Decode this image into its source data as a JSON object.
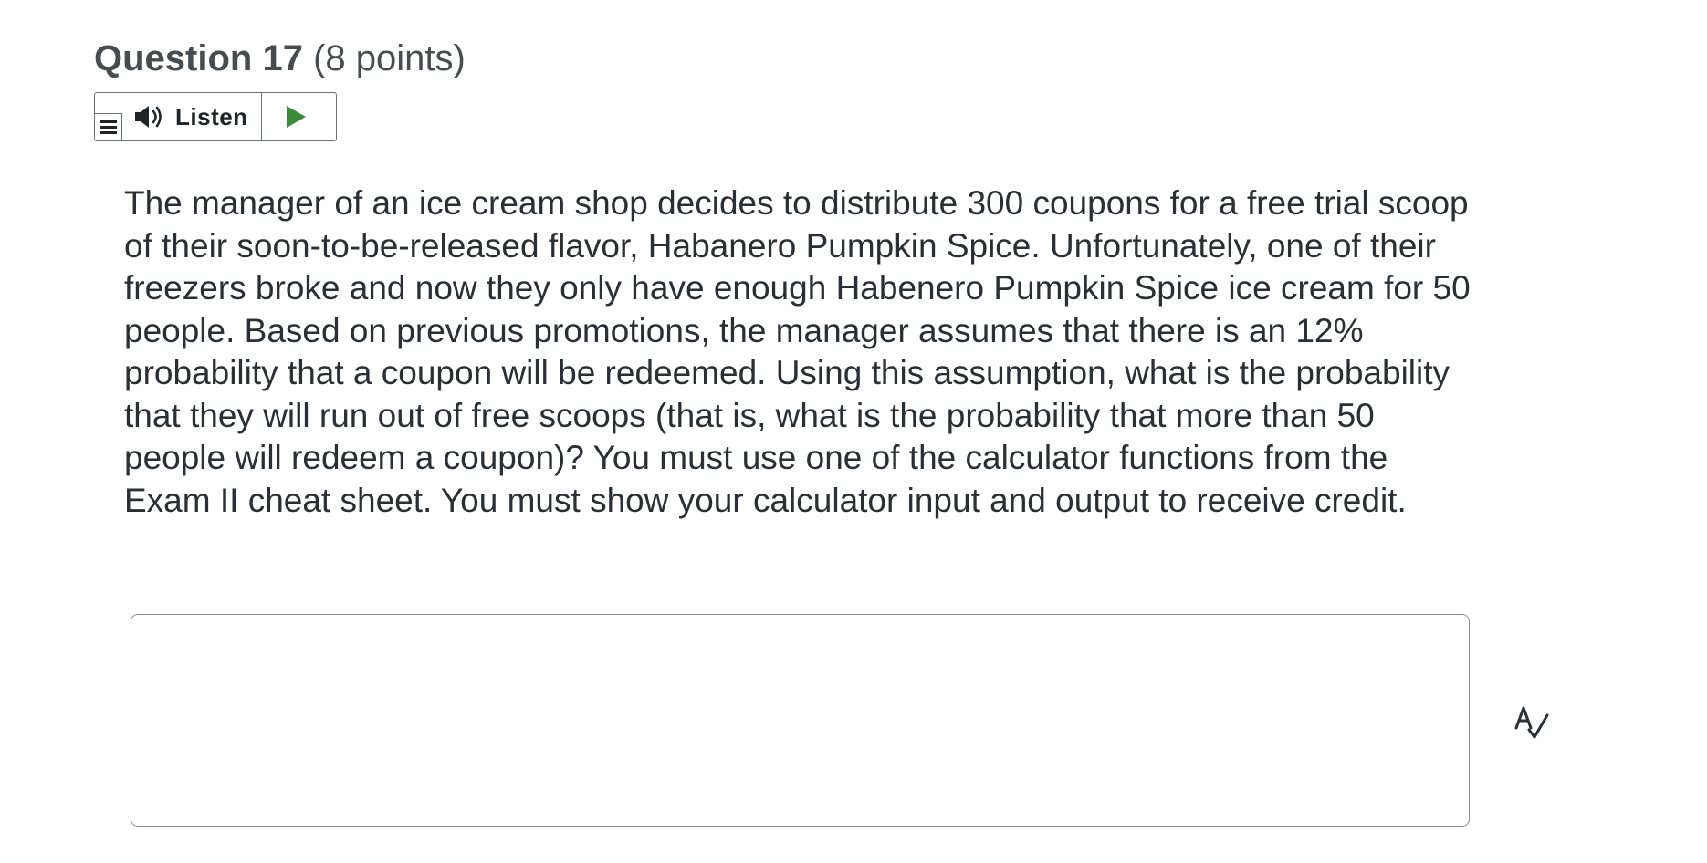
{
  "question": {
    "number_label": "Question 17",
    "points_label": "(8 points)"
  },
  "listen": {
    "label": "Listen",
    "menu_icon": "hamburger-menu-icon",
    "speaker_icon": "speaker-icon",
    "play_icon": "play-icon",
    "play_color": "#3c8a3c"
  },
  "body": {
    "text": "The manager of an ice cream shop decides to distribute 300 coupons for a free trial scoop of their soon-to-be-released flavor, Habanero Pumpkin Spice. Unfortunately, one of their freezers broke and now they only have enough Habenero Pumpkin Spice ice cream for 50 people. Based on previous promotions, the manager assumes that there is an 12% probability that a coupon will be redeemed. Using this assumption, what is the probability that they will run out of free scoops (that is, what is the probability that more than 50 people will redeem a coupon)?  You must use one of the calculator functions from the Exam II cheat sheet. You must show your calculator input and output to receive credit."
  },
  "answer": {
    "value": "",
    "placeholder": ""
  },
  "spellcheck": {
    "icon": "spellcheck-icon"
  }
}
